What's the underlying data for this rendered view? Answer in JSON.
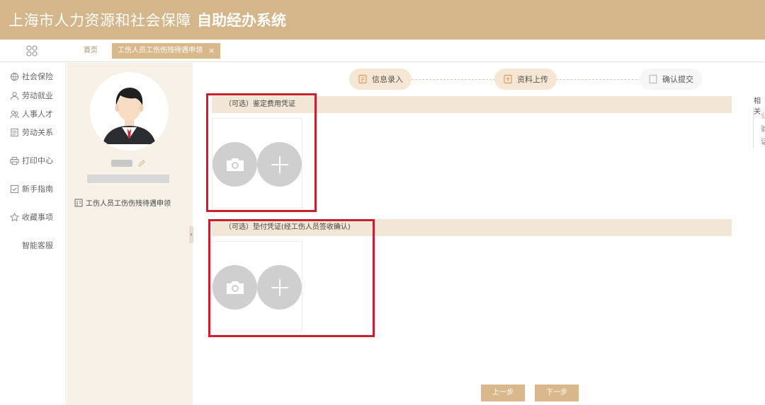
{
  "header": {
    "title_main": "上海市人力资源和社会保障",
    "title_bold": "自助经办系统"
  },
  "tabs": {
    "home": "首页",
    "active": "工伤人员工伤伤残待遇申领",
    "close": "×"
  },
  "sidebar": {
    "items": [
      {
        "label": "社会保险",
        "icon": "globe-icon"
      },
      {
        "label": "劳动就业",
        "icon": "person-icon"
      },
      {
        "label": "人事人才",
        "icon": "people-icon"
      },
      {
        "label": "劳动关系",
        "icon": "document-icon"
      },
      {
        "label": "打印中心",
        "icon": "printer-icon"
      },
      {
        "label": "新手指南",
        "icon": "guide-icon"
      },
      {
        "label": "收藏事项",
        "icon": "star-icon"
      },
      {
        "label": "智能客服",
        "icon": ""
      }
    ]
  },
  "profile": {
    "service_item": "工伤人员工伤伤残待遇申领"
  },
  "steps": [
    {
      "label": "信息录入",
      "state": "done"
    },
    {
      "label": "资料上传",
      "state": "current"
    },
    {
      "label": "确认提交",
      "state": "pending"
    }
  ],
  "sections": [
    {
      "title": "（可选）鉴定费用凭证"
    },
    {
      "title": "（可选）垫付凭证(经工伤人员签收确认)"
    }
  ],
  "right_panel": {
    "title_fragment": "相关",
    "chars": [
      "业",
      "验",
      "话"
    ]
  },
  "buttons": {
    "prev": "上一步",
    "next": "下一步"
  },
  "colors": {
    "header_bg": "#d4b68a",
    "accent": "#d9b98c",
    "section_bg": "#f2e6d6",
    "highlight_red": "#c8202c"
  }
}
